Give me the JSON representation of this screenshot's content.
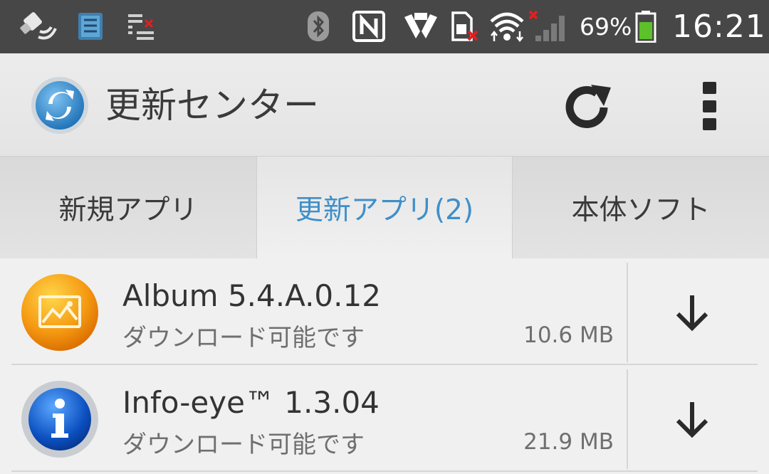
{
  "status_bar": {
    "battery_percent": "69%",
    "time": "16:21",
    "colors": {
      "background": "#474747",
      "battery_fill": "#5cc12a",
      "alert": "#e02020"
    },
    "icons": [
      "gps-icon",
      "app-notification-icon",
      "download-list-icon",
      "bluetooth-icon",
      "nfc-icon",
      "hands-icon",
      "sim-error-icon",
      "wifi-icon",
      "signal-icon",
      "battery-icon"
    ]
  },
  "action_bar": {
    "title": "更新センター",
    "icons": [
      "update-center-logo-icon",
      "refresh-icon",
      "overflow-menu-icon"
    ]
  },
  "tabs": [
    {
      "label": "新規アプリ",
      "selected": false
    },
    {
      "label": "更新アプリ(2)",
      "selected": true
    },
    {
      "label": "本体ソフト",
      "selected": false
    }
  ],
  "accent_color": "#3f8fc9",
  "updates": [
    {
      "name": "Album 5.4.A.0.12",
      "status": "ダウンロード可能です",
      "size": "10.6 MB",
      "icon": "album-app-icon"
    },
    {
      "name": "Info-eye™ 1.3.04",
      "status": "ダウンロード可能です",
      "size": "21.9 MB",
      "icon": "info-eye-app-icon"
    }
  ]
}
